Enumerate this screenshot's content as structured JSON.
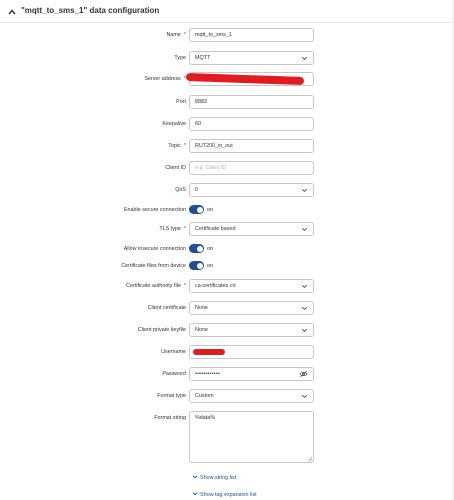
{
  "section": {
    "title": "\"mqtt_to_sms_1\" data configuration"
  },
  "fields": {
    "name": {
      "label": "Name",
      "value": "mqtt_to_sms_1"
    },
    "type": {
      "label": "Type",
      "value": "MQTT"
    },
    "server_address": {
      "label": "Server address",
      "value": ""
    },
    "port": {
      "label": "Port",
      "value": "8883"
    },
    "keepalive": {
      "label": "Keepalive",
      "value": "60"
    },
    "topic": {
      "label": "Topic",
      "value": "RUT200_in_out"
    },
    "client_id": {
      "label": "Client ID",
      "placeholder": "e.g. Client ID"
    },
    "qos": {
      "label": "QoS",
      "value": "0"
    },
    "enable_secure": {
      "label": "Enable secure connection",
      "state": "on"
    },
    "tls_type": {
      "label": "TLS type",
      "value": "Certificate based"
    },
    "allow_insecure": {
      "label": "Allow insecure connection",
      "state": "on"
    },
    "cert_from_device": {
      "label": "Certificate files from device",
      "state": "on"
    },
    "ca_file": {
      "label": "Certificate authority file",
      "value": "ca-certificates.crt"
    },
    "client_cert": {
      "label": "Client certificate",
      "value": "None"
    },
    "client_key": {
      "label": "Client private keyfile",
      "value": "None"
    },
    "username": {
      "label": "Username",
      "value": ""
    },
    "password": {
      "label": "Password",
      "value": "••••••••••••"
    },
    "format_type": {
      "label": "Format type",
      "value": "Custom"
    },
    "format_string": {
      "label": "Format string",
      "value": "%data%"
    }
  },
  "links": {
    "show_string_list": "Show string list",
    "show_tag_list": "Show tag expansion list"
  },
  "colors": {
    "accent": "#1f4e9c",
    "required": "#e02020",
    "redaction": "#e11b22"
  }
}
